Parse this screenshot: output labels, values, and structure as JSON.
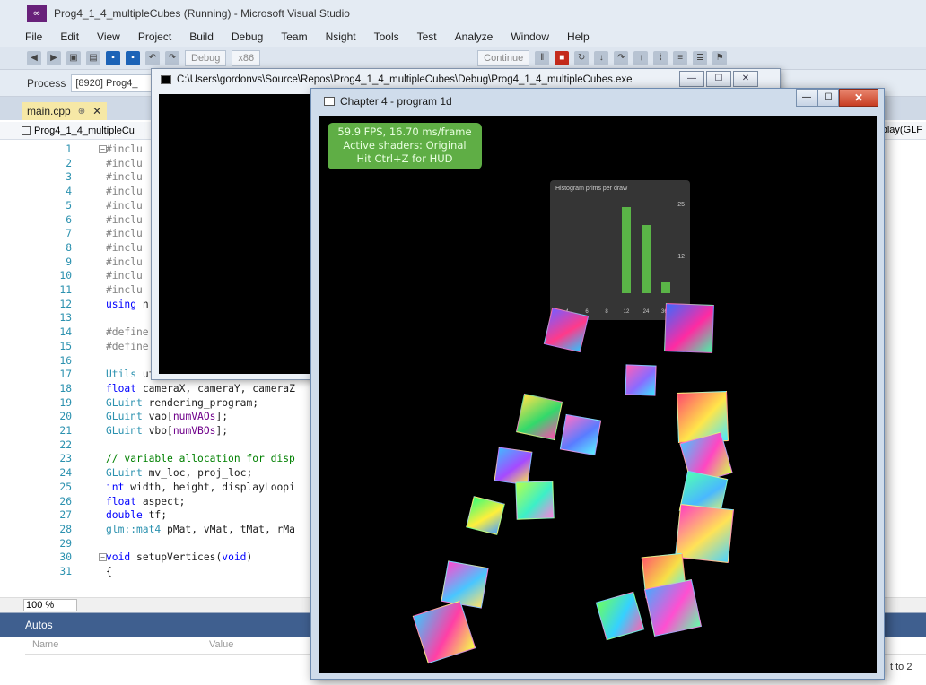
{
  "vs": {
    "title": "Prog4_1_4_multipleCubes (Running) - Microsoft Visual Studio",
    "logo_glyph": "∞",
    "menu": [
      "File",
      "Edit",
      "View",
      "Project",
      "Build",
      "Debug",
      "Team",
      "Nsight",
      "Tools",
      "Test",
      "Analyze",
      "Window",
      "Help"
    ],
    "toolbar": {
      "debug_dropdown": "Debug",
      "continue_label": "Continue"
    },
    "process_label": "Process",
    "process_value": "[8920] Prog4_",
    "doc_tab": {
      "label": "main.cpp",
      "pin": "⊕",
      "close": "✕"
    },
    "nav_left": "Prog4_1_4_multipleCu",
    "nav_right": "play(GLF",
    "code_lines": [
      {
        "n": "1",
        "text": "#inclu"
      },
      {
        "n": "2",
        "text": "#inclu"
      },
      {
        "n": "3",
        "text": "#inclu"
      },
      {
        "n": "4",
        "text": "#inclu"
      },
      {
        "n": "5",
        "text": "#inclu"
      },
      {
        "n": "6",
        "text": "#inclu"
      },
      {
        "n": "7",
        "text": "#inclu"
      },
      {
        "n": "8",
        "text": "#inclu"
      },
      {
        "n": "9",
        "text": "#inclu"
      },
      {
        "n": "10",
        "text": "#inclu"
      },
      {
        "n": "11",
        "text": "#inclu"
      },
      {
        "n": "12",
        "text": "using n"
      },
      {
        "n": "13",
        "text": ""
      },
      {
        "n": "14",
        "text": "#define"
      },
      {
        "n": "15",
        "text": "#define"
      },
      {
        "n": "16",
        "text": ""
      },
      {
        "n": "17",
        "text": "Utils util = Utils();"
      },
      {
        "n": "18",
        "text": "float cameraX, cameraY, cameraZ"
      },
      {
        "n": "19",
        "text": "GLuint rendering_program;"
      },
      {
        "n": "20",
        "text": "GLuint vao[numVAOs];"
      },
      {
        "n": "21",
        "text": "GLuint vbo[numVBOs];"
      },
      {
        "n": "22",
        "text": ""
      },
      {
        "n": "23",
        "text": "// variable allocation for disp"
      },
      {
        "n": "24",
        "text": "GLuint mv_loc, proj_loc;"
      },
      {
        "n": "25",
        "text": "int width, height, displayLoopi"
      },
      {
        "n": "26",
        "text": "float aspect;"
      },
      {
        "n": "27",
        "text": "double tf;"
      },
      {
        "n": "28",
        "text": "glm::mat4 pMat, vMat, tMat, rMa"
      },
      {
        "n": "29",
        "text": ""
      },
      {
        "n": "30",
        "text": "void setupVertices(void)"
      },
      {
        "n": "31",
        "text": "{"
      }
    ],
    "zoom": "100 %",
    "autos": {
      "title": "Autos",
      "col_name": "Name",
      "col_value": "Value"
    },
    "bottom_right_text": "t to 2"
  },
  "console": {
    "title": "C:\\Users\\gordonvs\\Source\\Repos\\Prog4_1_4_multipleCubes\\Debug\\Prog4_1_4_multipleCubes.exe",
    "min": "—",
    "max": "☐",
    "close": "✕"
  },
  "gl_window": {
    "title": "Chapter 4 - program 1d",
    "min": "—",
    "max": "☐",
    "close": "✕",
    "hud": {
      "line1": "59.9 FPS, 16.70 ms/frame",
      "line2": "Active shaders: Original",
      "line3": "Hit Ctrl+Z for HUD"
    },
    "histogram": {
      "title": "Histogram prims per draw",
      "max_label": "25",
      "mid_label": "12",
      "bars": [
        {
          "label": "4",
          "value": 0
        },
        {
          "label": "6",
          "value": 0
        },
        {
          "label": "8",
          "value": 0
        },
        {
          "label": "12",
          "value": 24
        },
        {
          "label": "24",
          "value": 19
        },
        {
          "label": "36+",
          "value": 3
        }
      ]
    }
  },
  "colors": {
    "vs_purple": "#68217a",
    "hud_green": "#5fae45",
    "histogram_bar": "#62c44e",
    "autos_header": "#3f5f8f",
    "close_red": "#c73d22"
  }
}
